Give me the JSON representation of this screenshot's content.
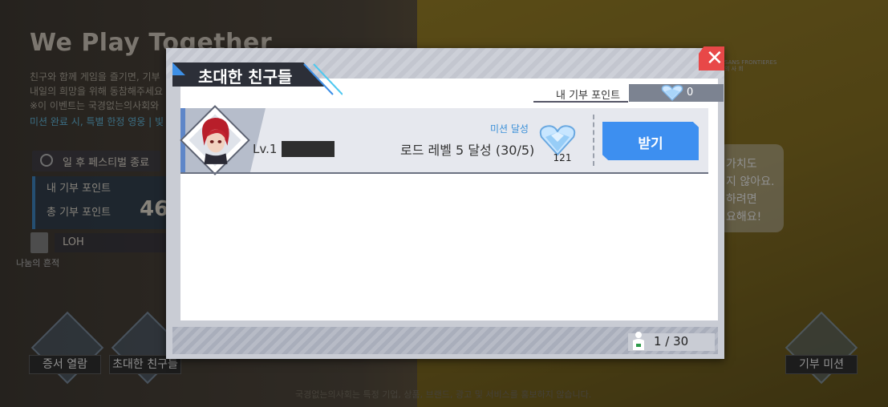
{
  "background": {
    "title": "We Play Together",
    "desc_lines": [
      "친구와 함께 게임을 즐기면, 기부",
      "내일의 희망을 위해 동참해주세요",
      "※이 이벤트는 국경없는의사회와",
      "미션 완료 시, 특별 한정 영웅 | 빛"
    ],
    "festival_end": "일 후 페스티벌 종료",
    "my_points_label": "내 기부 포인트",
    "total_points_label": "총 기부 포인트",
    "total_points_value": "46",
    "loh_label": "LOH",
    "left_small": "나눔의 흔적",
    "btn_certificate": "증서 열람",
    "btn_invited": "초대한 친구들",
    "btn_donate_mission": "기부 미션",
    "bubble_lines": [
      "가치도",
      "지 않아요.",
      "하려면",
      "요해요!"
    ],
    "footer_note": "국경없는의사회는 특정 기업, 상품, 브랜드, 광고 및 서비스를 홍보하지 않습니다.",
    "logo_line1": "SANS FRONTIERES",
    "logo_line2": "의 사 회"
  },
  "modal": {
    "title": "초대한 친구들",
    "close_label": "✕",
    "my_points_label": "내 기부 포인트",
    "my_points_value": "0",
    "friends": [
      {
        "level": "Lv.1",
        "mission_status": "미션 달성",
        "mission_desc": "로드 레벨 5 달성 (30/5)",
        "reward_count": "121",
        "claim_label": "받기"
      }
    ],
    "page_count": "1 / 30"
  },
  "colors": {
    "accent_blue": "#3d8ff0",
    "close_red": "#e84848",
    "status_blue": "#3a8fd8"
  },
  "icons": [
    "heart-gem-icon",
    "person-icon",
    "close-icon",
    "clock-icon"
  ]
}
